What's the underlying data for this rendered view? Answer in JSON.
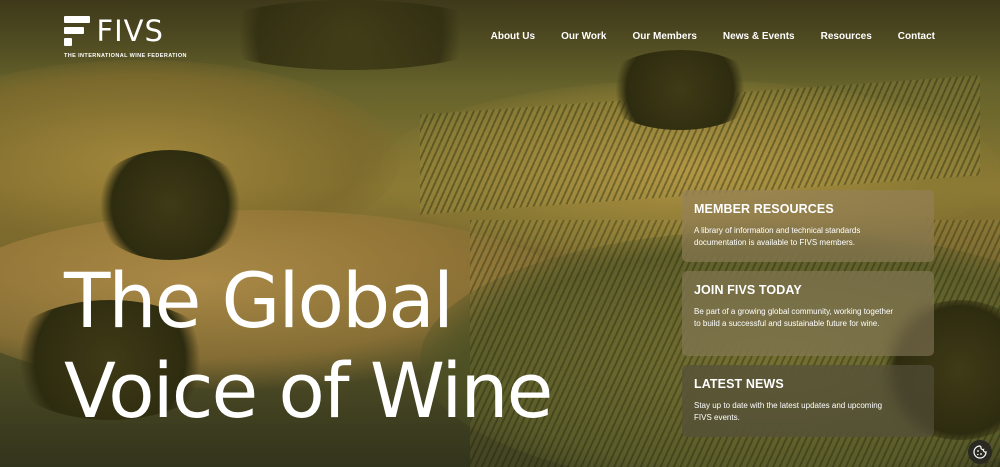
{
  "brand": {
    "name": "FIVS",
    "tagline": "THE INTERNATIONAL WINE FEDERATION"
  },
  "nav": {
    "items": [
      {
        "label": "About Us"
      },
      {
        "label": "Our Work"
      },
      {
        "label": "Our Members"
      },
      {
        "label": "News & Events"
      },
      {
        "label": "Resources"
      },
      {
        "label": "Contact"
      }
    ]
  },
  "hero": {
    "headline_line1": "The Global",
    "headline_line2": "Voice of Wine"
  },
  "cards": [
    {
      "title": "MEMBER RESOURCES",
      "text": "A library of information and technical standards documentation is available to FIVS members."
    },
    {
      "title": "JOIN FIVS TODAY",
      "text": "Be part of a growing global community, working together to build a successful and sustainable future for wine."
    },
    {
      "title": "LATEST NEWS",
      "text": "Stay up to date with the latest updates and upcoming FIVS events."
    }
  ],
  "cookie_button": {
    "icon": "cookie-icon"
  },
  "colors": {
    "text": "#ffffff",
    "card_bg": "#96825f",
    "card_dark_bg": "#55503c"
  }
}
